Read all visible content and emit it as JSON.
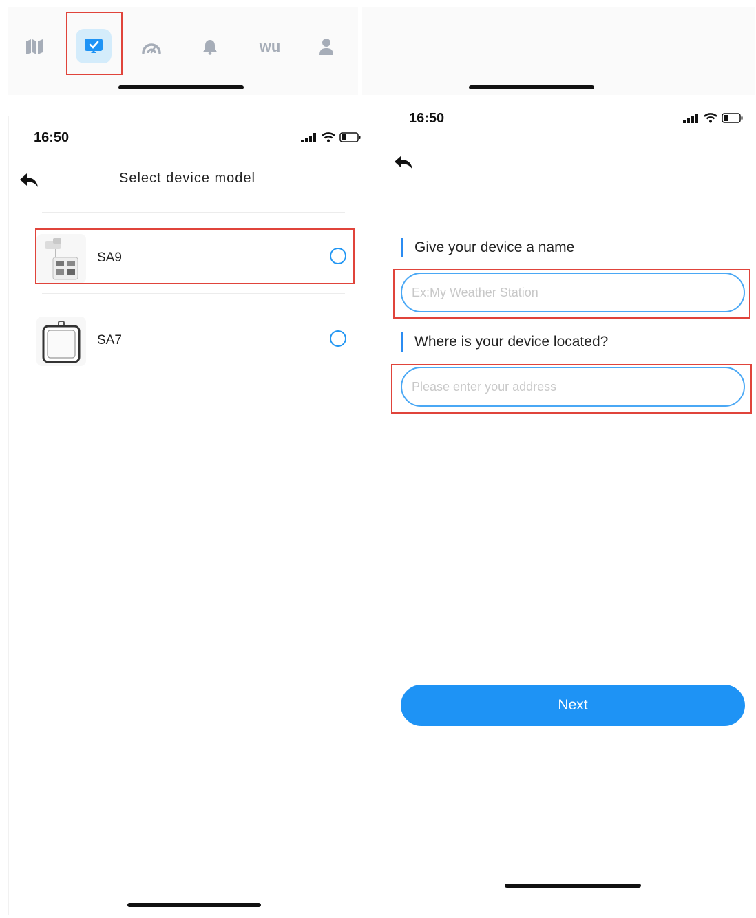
{
  "tab_bar": {
    "icons": [
      "map-icon",
      "device-icon",
      "gauge-icon",
      "bell-icon",
      "wu-icon",
      "user-icon"
    ],
    "wu_text": "wu",
    "active_index": 1
  },
  "select_model_screen": {
    "time": "16:50",
    "title": "Select device model",
    "devices": [
      {
        "label": "SA9",
        "selected": false
      },
      {
        "label": "SA7",
        "selected": false
      }
    ]
  },
  "device_setup_screen": {
    "time": "16:50",
    "name_section": {
      "label": "Give your device a name",
      "placeholder": "Ex:My Weather Station"
    },
    "location_section": {
      "label": "Where is your device located?",
      "placeholder": "Please enter your address"
    },
    "next_label": "Next"
  },
  "colors": {
    "accent": "#1e93f5",
    "highlight": "#e0443b",
    "icon_gray": "#a6adb8"
  }
}
